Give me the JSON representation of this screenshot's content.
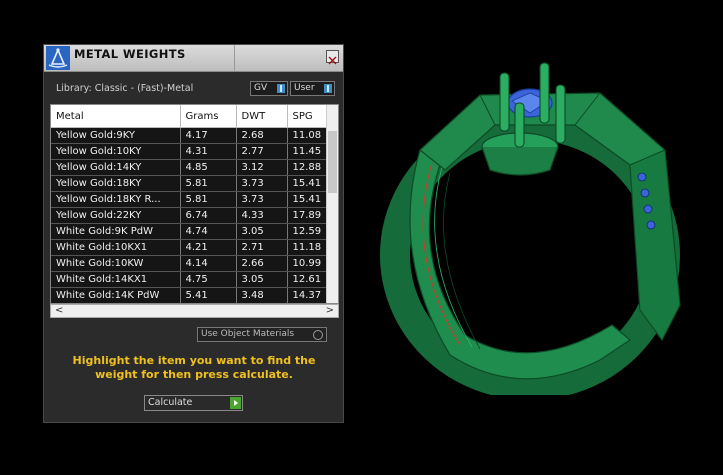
{
  "panel": {
    "title": "METAL WEIGHTS",
    "library": "Library: Classic - (Fast)-Metal",
    "toggle_gv": "GV",
    "toggle_user": "User",
    "columns": [
      "Metal",
      "Grams",
      "DWT",
      "SPG"
    ],
    "rows": [
      [
        "Yellow Gold:9KY",
        "4.17",
        "2.68",
        "11.08"
      ],
      [
        "Yellow Gold:10KY",
        "4.31",
        "2.77",
        "11.45"
      ],
      [
        "Yellow Gold:14KY",
        "4.85",
        "3.12",
        "12.88"
      ],
      [
        "Yellow Gold:18KY",
        "5.81",
        "3.73",
        "15.41"
      ],
      [
        "Yellow Gold:18KY R...",
        "5.81",
        "3.73",
        "15.41"
      ],
      [
        "Yellow Gold:22KY",
        "6.74",
        "4.33",
        "17.89"
      ],
      [
        "White Gold:9K PdW",
        "4.74",
        "3.05",
        "12.59"
      ],
      [
        "White Gold:10KX1",
        "4.21",
        "2.71",
        "11.18"
      ],
      [
        "White Gold:10KW",
        "4.14",
        "2.66",
        "10.99"
      ],
      [
        "White Gold:14KX1",
        "4.75",
        "3.05",
        "12.61"
      ],
      [
        "White Gold:14K PdW",
        "5.41",
        "3.48",
        "14.37"
      ]
    ],
    "use_object_materials": "Use Object Materials",
    "hint": "Highlight the item you want to find the weight for then press calculate.",
    "calculate": "Calculate",
    "scroll_left": "<",
    "scroll_right": ">"
  },
  "viewport": {
    "model": "ring-3d-model",
    "colors": {
      "metal": "#1f8a4c",
      "stone": "#3a64d8",
      "edge": "#0d4a26"
    }
  }
}
